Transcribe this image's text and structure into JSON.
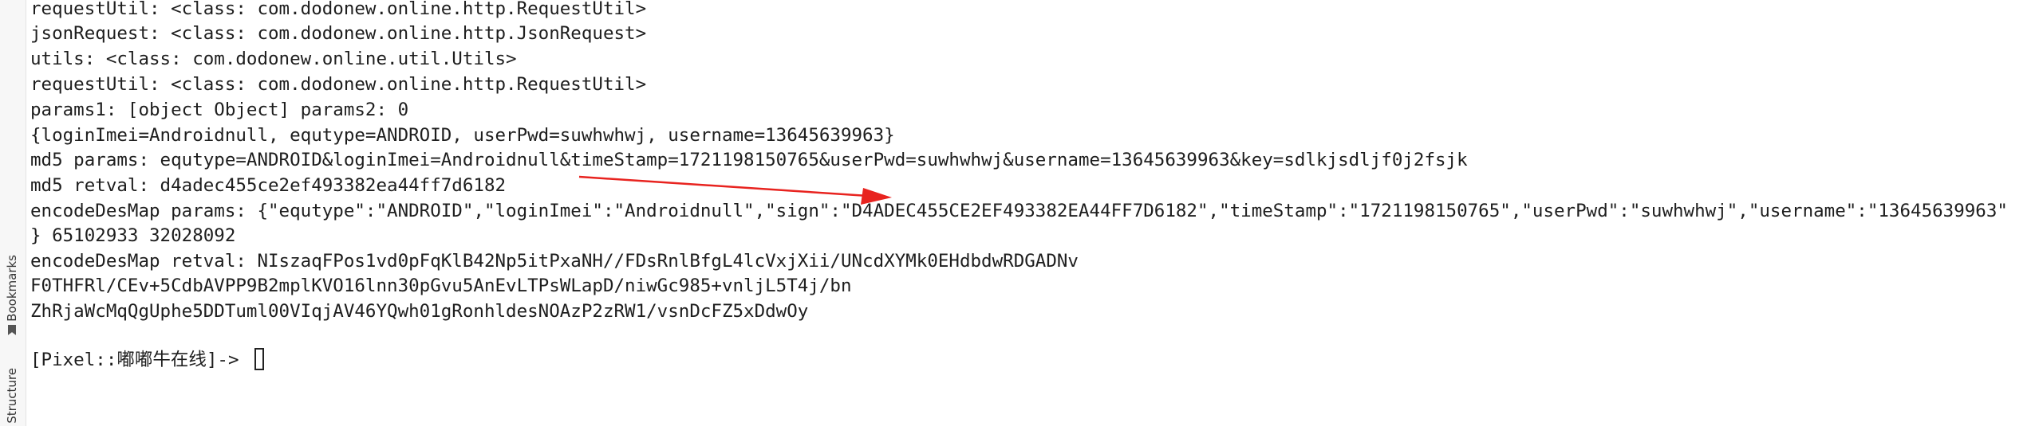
{
  "sidebar": {
    "bookmarks_label": "Bookmarks",
    "structure_label": "Structure"
  },
  "console": {
    "lines": [
      "requestUtil: <class: com.dodonew.online.http.RequestUtil>",
      "jsonRequest: <class: com.dodonew.online.http.JsonRequest>",
      "utils: <class: com.dodonew.online.util.Utils>",
      "requestUtil: <class: com.dodonew.online.http.RequestUtil>",
      "params1: [object Object] params2: 0",
      "{loginImei=Androidnull, equtype=ANDROID, userPwd=suwhwhwj, username=13645639963}",
      "md5 params: equtype=ANDROID&loginImei=Androidnull&timeStamp=1721198150765&userPwd=suwhwhwj&username=13645639963&key=sdlkjsdljf0j2fsjk",
      "md5 retval: d4adec455ce2ef493382ea44ff7d6182",
      "encodeDesMap params: {\"equtype\":\"ANDROID\",\"loginImei\":\"Androidnull\",\"sign\":\"D4ADEC455CE2EF493382EA44FF7D6182\",\"timeStamp\":\"1721198150765\",\"userPwd\":\"suwhwhwj\",\"username\":\"13645639963\"",
      "} 65102933 32028092",
      "encodeDesMap retval: NIszaqFPos1vd0pFqKlB42Np5itPxaNH//FDsRnlBfgL4lcVxjXii/UNcdXYMk0EHdbdwRDGADNv",
      "F0THFRl/CEv+5CdbAVPP9B2mplKVO16lnn30pGvu5AnEvLTPsWLapD/niwGc985+vnljL5T4j/bn",
      "ZhRjaWcMqQgUphe5DDTuml00VIqjAV46YQwh01gRonhldesNOAzP2zRW1/vsnDcFZ5xDdwOy"
    ],
    "prompt": "[Pixel::嘟嘟牛在线]-> "
  },
  "colors": {
    "arrow": "#e8231f",
    "text": "#1e1e1e",
    "background": "#ffffff"
  }
}
